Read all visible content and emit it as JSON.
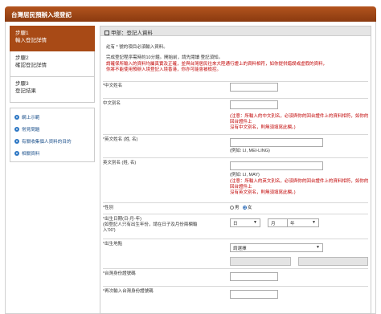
{
  "header": {
    "title": "台灣居民預辦入境登記"
  },
  "steps": [
    {
      "line1": "步驟1",
      "line2": "輸入登記詳情"
    },
    {
      "line1": "步驟2",
      "line2": "確認登記詳情"
    },
    {
      "line1": "步驟3",
      "line2": "登記結果"
    }
  ],
  "links": [
    {
      "label": "網上示範",
      "icon": "info-icon"
    },
    {
      "label": "常見問題",
      "icon": "info-icon"
    },
    {
      "label": "有關收集個人資料的目的",
      "icon": "info-icon"
    },
    {
      "label": "相關資料",
      "icon": "info-icon"
    }
  ],
  "section": {
    "title": "甲部：登記人資料"
  },
  "intro": {
    "note": "註有 * 號的項目必須輸入資料。",
    "time": "完成登記程序需時約10分鐘。開始前，請先閱讀 登記須知。",
    "warn1": "請確保所輸入的資料均屬真實及正確，並與台灣居民往來大陸通行證上的資料相符，如你提供錯誤或虛假的資料，",
    "warn2": "你將不能使用預辦入境登記入境香港，你亦可能會被檢控。"
  },
  "form": {
    "chinese_name": "*中文姓名",
    "chinese_alias": "中文別名",
    "alias_note1": "(注意：所輸入的中文別名，必須與你的回台證件上的資料相符，如你的回台證件上",
    "alias_note2": "沒有中文別名，則無須填寫此欄。)",
    "english_name": "*英文姓名 (姓, 名)",
    "english_example": "(例如: LI, MEI-LING)",
    "english_alias": "英文別名 (姓, 名)",
    "english_alias_example": "(例如: LI, MAY)",
    "ealias_note1": "(注意：所輸入的英文別名，必須與你的回台證件上的資料相符，如你的回台證件上",
    "ealias_note2": "沒有英文別名，則無須填寫此欄。)",
    "sex": "*性別",
    "male": "男",
    "female": "女",
    "dob": "*出生日期(日-月-年)",
    "dob_note1": "(如登記人只有出生年份，請在日子及月份兩欄輸",
    "dob_note2": "入'00')",
    "day": "日",
    "month": "月",
    "year": "年",
    "birthplace": "*出生地點",
    "birthplace_select": "請選擇",
    "tw_id": "*台灣身份證號碼",
    "tw_id_confirm": "*再次輸入台灣身份證號碼"
  }
}
